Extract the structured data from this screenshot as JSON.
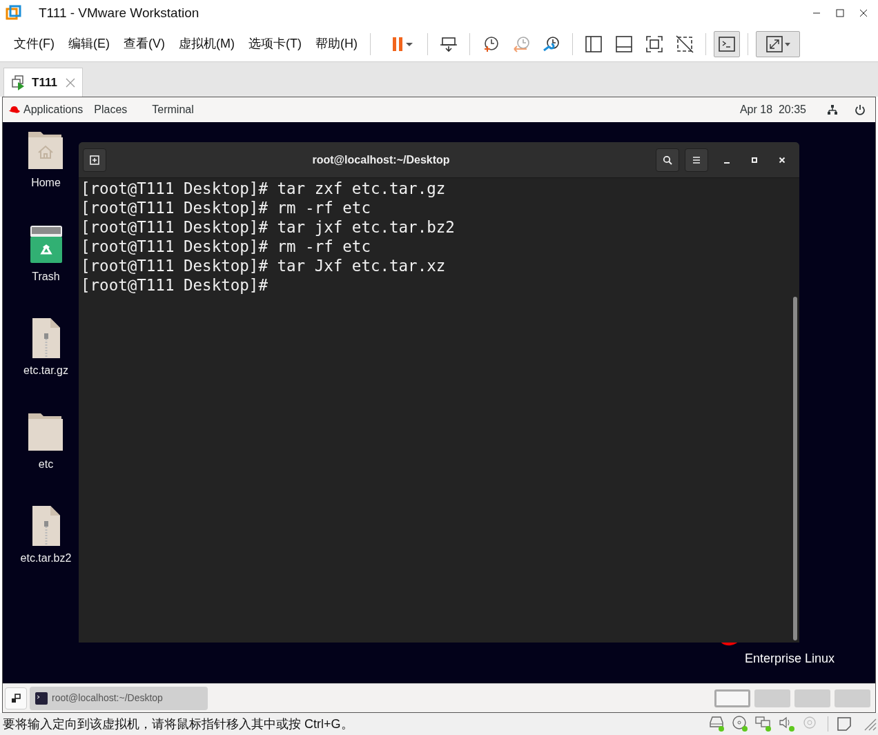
{
  "window": {
    "title": "T111 - VMware Workstation"
  },
  "menu": [
    "文件(F)",
    "编辑(E)",
    "查看(V)",
    "虚拟机(M)",
    "选项卡(T)",
    "帮助(H)"
  ],
  "toolbar": [
    {
      "kind": "pause"
    },
    {
      "kind": "sep"
    },
    {
      "kind": "send"
    },
    {
      "kind": "sep"
    },
    {
      "kind": "snap-take"
    },
    {
      "kind": "snap-revert"
    },
    {
      "kind": "snap-manage"
    },
    {
      "kind": "sep"
    },
    {
      "kind": "sidebar"
    },
    {
      "kind": "bottombar"
    },
    {
      "kind": "fullscreen"
    },
    {
      "kind": "unity"
    },
    {
      "kind": "sep"
    },
    {
      "kind": "console",
      "selected": true
    },
    {
      "kind": "sep"
    },
    {
      "kind": "stretch",
      "selected": true
    }
  ],
  "tabs": [
    {
      "label": "T111",
      "selected": true
    }
  ],
  "gnome_bar": {
    "menus": [
      "Applications",
      "Places",
      "Terminal"
    ],
    "clock": "Apr 18  20:35"
  },
  "desktop_icons": [
    {
      "kind": "home",
      "label": "Home"
    },
    {
      "kind": "trash",
      "label": "Trash"
    },
    {
      "kind": "archive",
      "label": "etc.tar.gz"
    },
    {
      "kind": "folder",
      "label": "etc"
    },
    {
      "kind": "archive",
      "label": "etc.tar.bz2"
    }
  ],
  "branding": [
    "Enterprise Linux"
  ],
  "terminal": {
    "title": "root@localhost:~/Desktop",
    "lines": [
      "[root@T111 Desktop]# tar zxf etc.tar.gz",
      "[root@T111 Desktop]# rm -rf etc",
      "[root@T111 Desktop]# tar jxf etc.tar.bz2",
      "[root@T111 Desktop]# rm -rf etc",
      "[root@T111 Desktop]# tar Jxf etc.tar.xz",
      "[root@T111 Desktop]#"
    ]
  },
  "taskbar": {
    "window": "root@localhost:~/Desktop",
    "workspaces": [
      {
        "selected": true
      },
      {
        "selected": false
      },
      {
        "selected": false
      },
      {
        "selected": false
      }
    ]
  },
  "status_bar": {
    "message": "要将输入定向到该虚拟机，请将鼠标指针移入其中或按 Ctrl+G。",
    "devices": [
      {
        "kind": "disk",
        "active": true
      },
      {
        "kind": "cd",
        "active": true
      },
      {
        "kind": "network",
        "active": true
      },
      {
        "kind": "sound",
        "active": true
      },
      {
        "kind": "camera",
        "active": false
      }
    ]
  }
}
